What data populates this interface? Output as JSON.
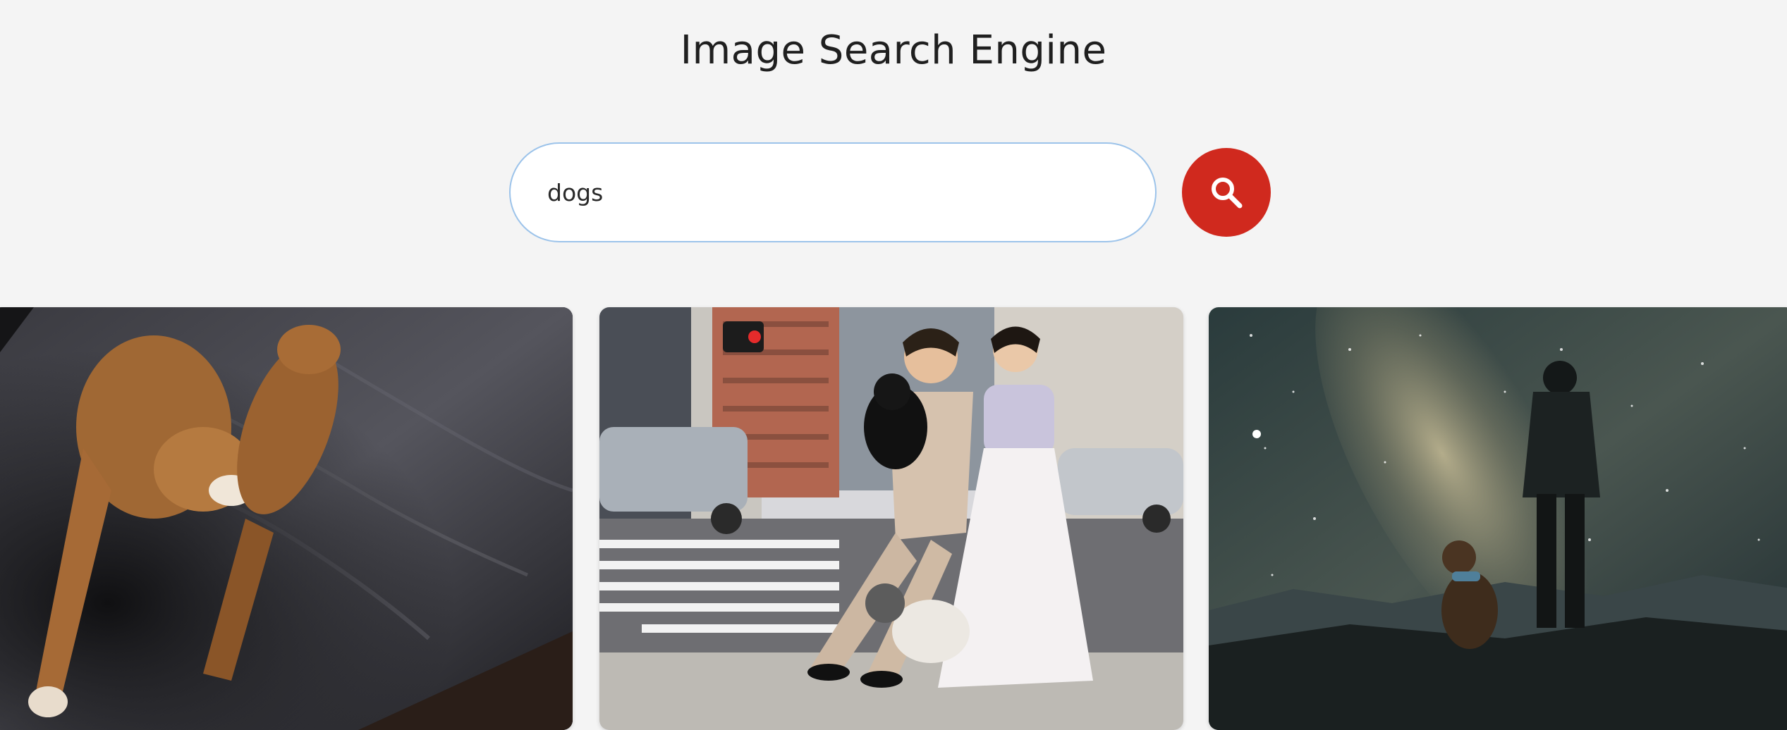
{
  "header": {
    "title": "Image Search Engine"
  },
  "search": {
    "value": "dogs",
    "button_icon": "search-icon"
  },
  "colors": {
    "background": "#f4f4f4",
    "accent": "#d0291e",
    "input_border": "#9cc3ea"
  },
  "results": [
    {
      "subject": "two dogs on a bed"
    },
    {
      "subject": "wedding couple with dogs on a city street"
    },
    {
      "subject": "person and dog under the milky way"
    }
  ]
}
